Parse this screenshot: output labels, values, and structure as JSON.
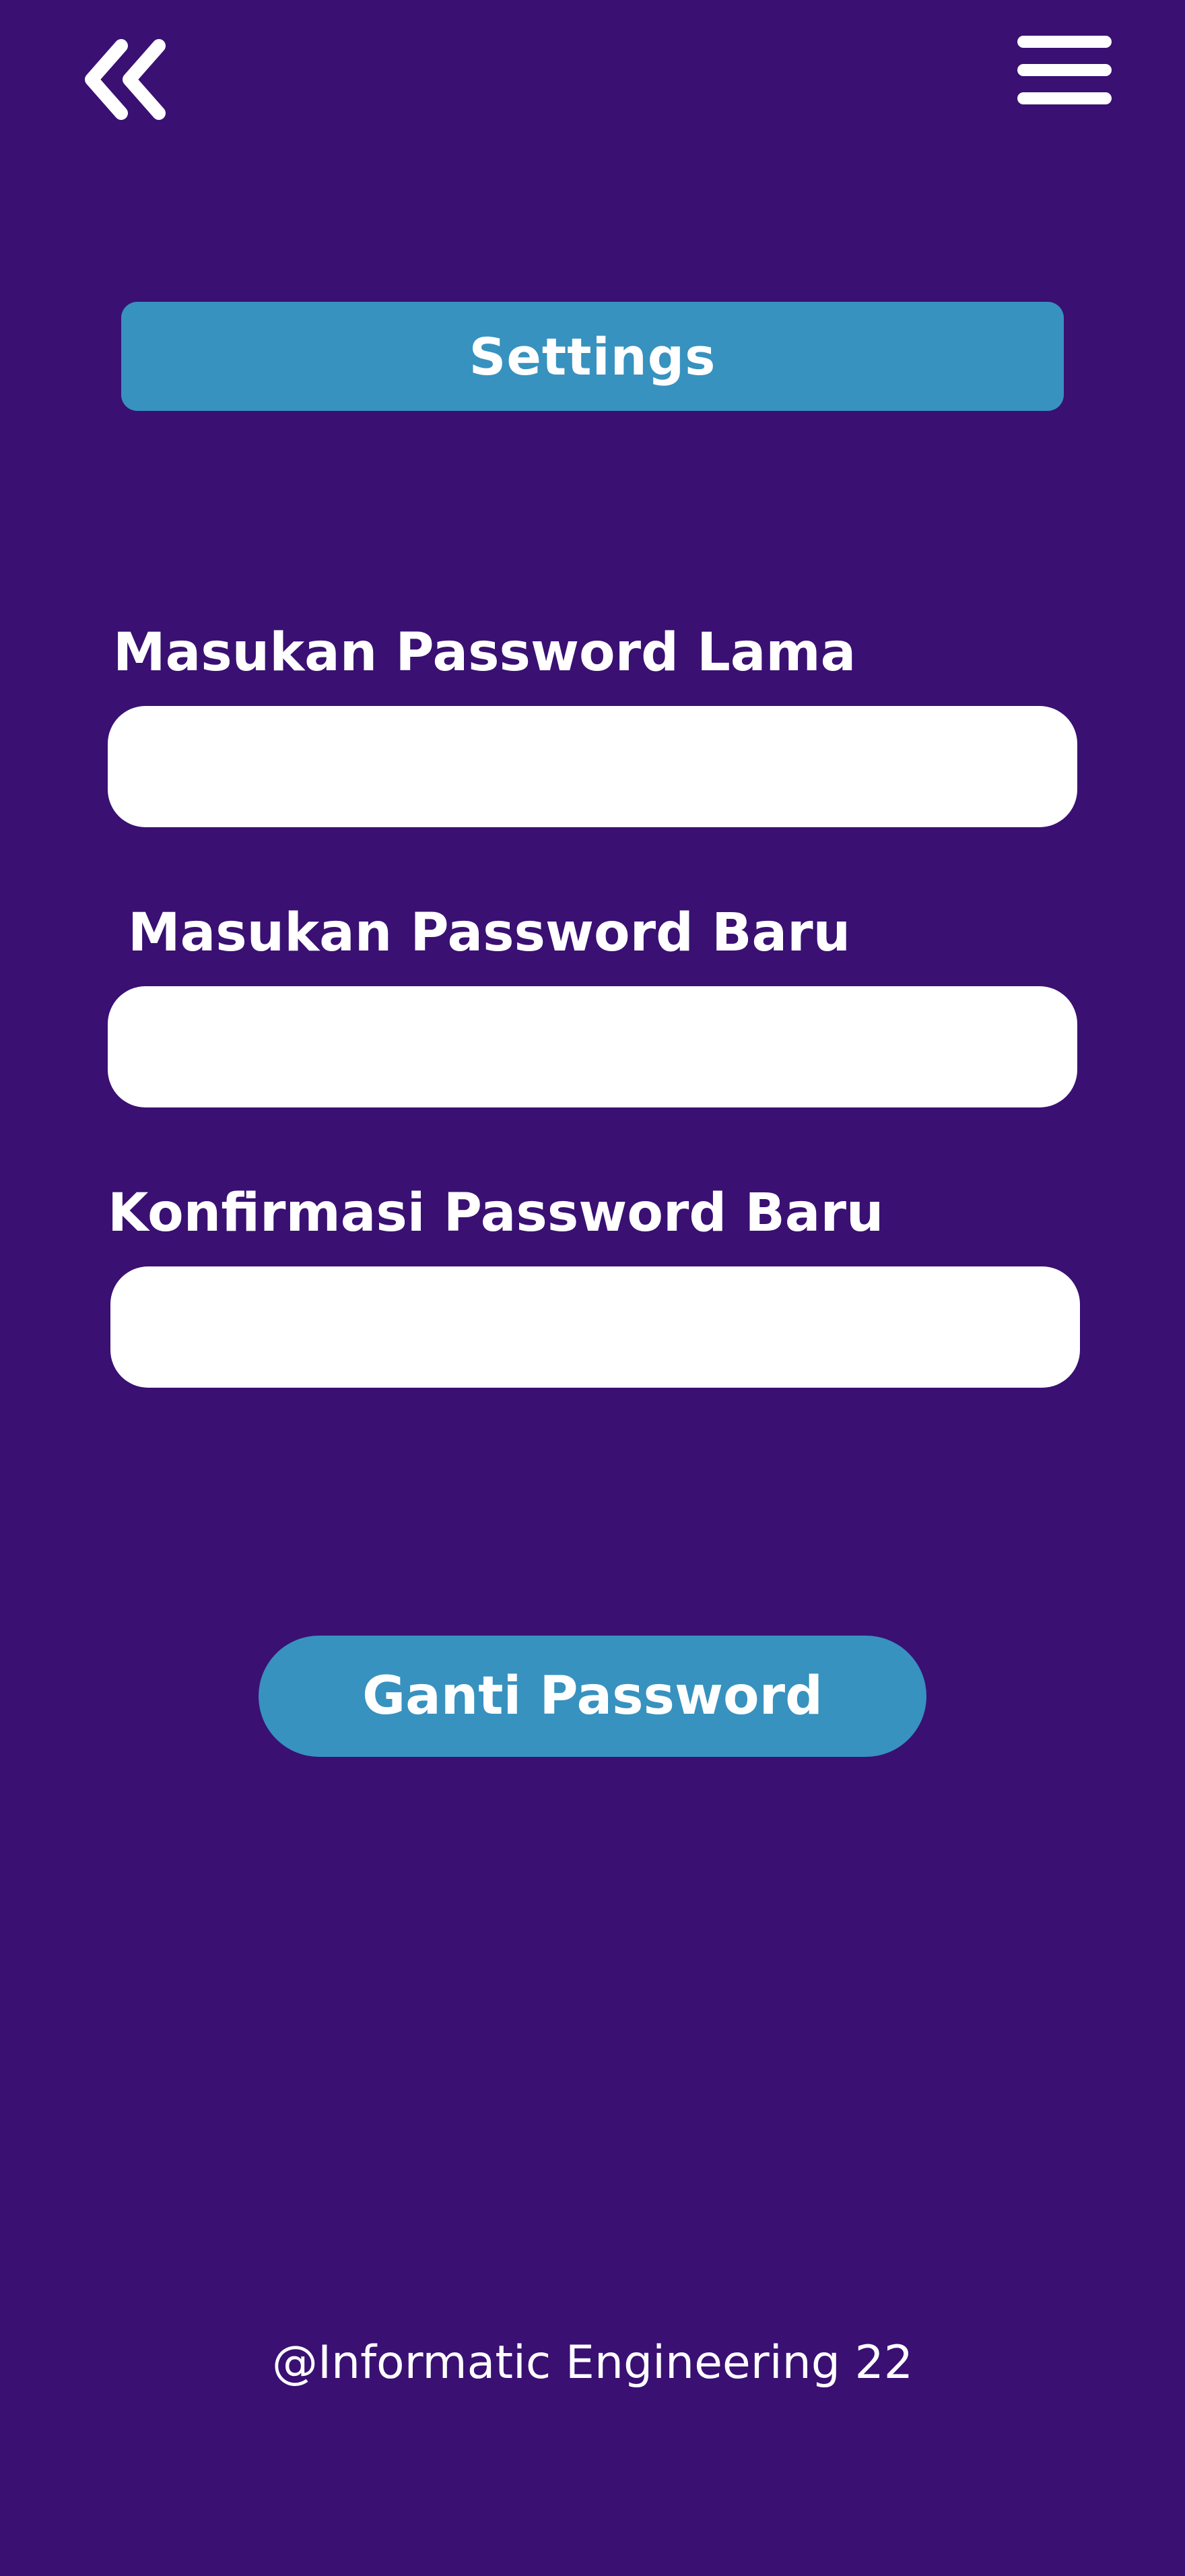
{
  "header": {
    "back_icon": "double-chevron-left-icon",
    "menu_icon": "hamburger-menu-icon"
  },
  "page": {
    "title": "Settings"
  },
  "form": {
    "old_password_label": "Masukan Password Lama",
    "old_password_value": "",
    "new_password_label": "Masukan Password Baru",
    "new_password_value": "",
    "confirm_password_label": "Konfirmasi Password Baru",
    "confirm_password_value": "",
    "submit_label": "Ganti Password"
  },
  "footer": {
    "text": "@Informatic Engineering 22"
  },
  "colors": {
    "background": "#3a1073",
    "accent": "#3792bf",
    "text": "#ffffff",
    "input_bg": "#ffffff"
  }
}
